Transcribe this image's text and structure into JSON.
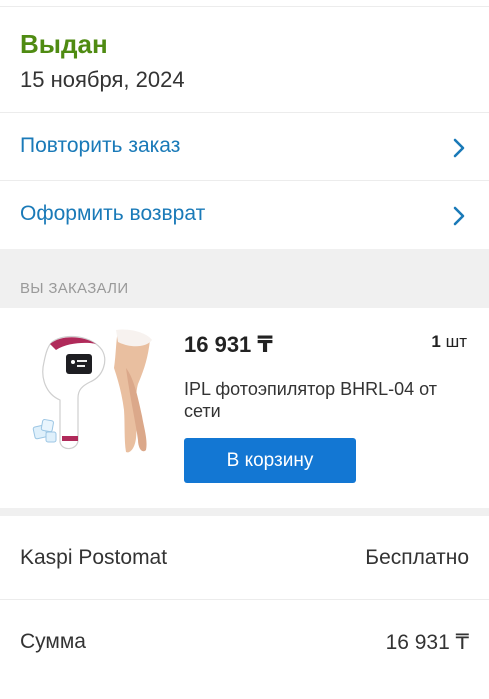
{
  "order_status": {
    "title": "Выдан",
    "date": "15 ноября, 2024",
    "title_color": "#4f8b12"
  },
  "actions": [
    {
      "label": "Повторить заказ",
      "icon": "chevron-right-icon"
    },
    {
      "label": "Оформить возврат",
      "icon": "chevron-right-icon"
    }
  ],
  "ordered_section": {
    "label": "ВЫ ЗАКАЗАЛИ"
  },
  "product": {
    "price": "16 931 ₸",
    "quantity": "1",
    "quantity_unit": "шт",
    "title": "IPL фотоэпилятор BHRL-04 от сети",
    "add_to_cart_label": "В корзину",
    "button_color": "#1377d3"
  },
  "summary": {
    "delivery": {
      "label": "Kaspi Postomat",
      "value": "Бесплатно"
    },
    "total": {
      "label": "Сумма",
      "value": "16 931 ₸"
    }
  },
  "accent_color": "#1a7ab8"
}
